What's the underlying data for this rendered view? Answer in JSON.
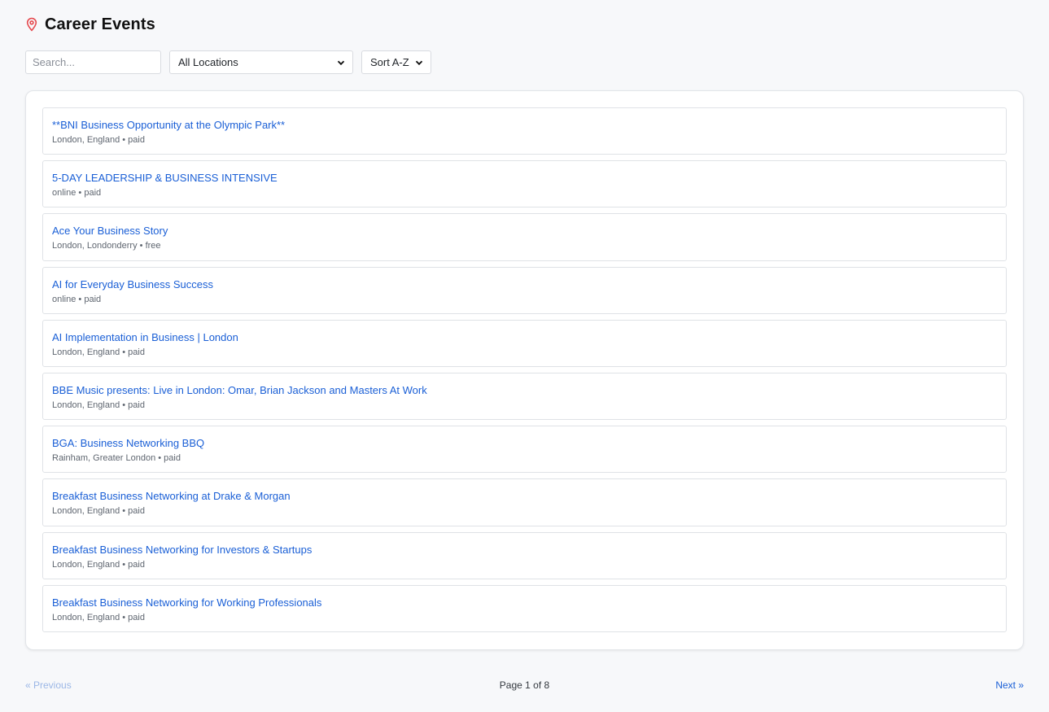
{
  "header": {
    "icon": "map-pin-icon",
    "title": "Career Events",
    "accent_color": "#e5484d"
  },
  "controls": {
    "search_placeholder": "Search...",
    "search_value": "",
    "location_selected": "All Locations",
    "sort_selected": "Sort A-Z"
  },
  "events": [
    {
      "title": "**BNI Business Opportunity at the Olympic Park**",
      "location": "London, England",
      "price": "paid"
    },
    {
      "title": "5-DAY LEADERSHIP & BUSINESS INTENSIVE",
      "location": "online",
      "price": "paid"
    },
    {
      "title": "Ace Your Business Story",
      "location": "London, Londonderry",
      "price": "free"
    },
    {
      "title": "AI for Everyday Business Success",
      "location": "online",
      "price": "paid"
    },
    {
      "title": "AI Implementation in Business | London",
      "location": "London, England",
      "price": "paid"
    },
    {
      "title": "BBE Music presents: Live in London: Omar, Brian Jackson and Masters At Work",
      "location": "London, England",
      "price": "paid"
    },
    {
      "title": "BGA: Business Networking BBQ",
      "location": "Rainham, Greater London",
      "price": "paid"
    },
    {
      "title": "Breakfast Business Networking at Drake & Morgan",
      "location": "London, England",
      "price": "paid"
    },
    {
      "title": "Breakfast Business Networking for Investors & Startups",
      "location": "London, England",
      "price": "paid"
    },
    {
      "title": "Breakfast Business Networking for Working Professionals",
      "location": "London, England",
      "price": "paid"
    }
  ],
  "pagination": {
    "prev_label": "« Previous",
    "page_info": "Page 1 of 8",
    "next_label": "Next »",
    "current_page": 1,
    "total_pages": 8
  },
  "colors": {
    "link": "#1a5fd6",
    "link_disabled": "#9bb7e6",
    "background": "#f7f8fa"
  }
}
